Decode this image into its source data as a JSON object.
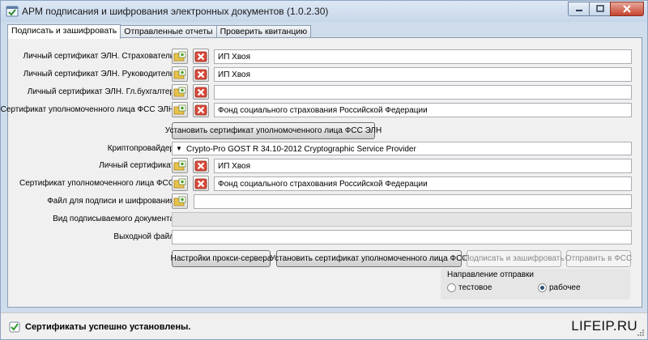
{
  "window": {
    "title": "АРМ подписания и шифрования электронных документов (1.0.2.30)"
  },
  "tabs": [
    {
      "label": "Подписать и зашифровать",
      "active": true
    },
    {
      "label": "Отправленные отчеты",
      "active": false
    },
    {
      "label": "Проверить квитанцию",
      "active": false
    }
  ],
  "certs": {
    "insurer": {
      "label": "Личный сертификат ЭЛН. Страхователь",
      "value": "ИП Хвоя"
    },
    "director": {
      "label": "Личный сертификат ЭЛН. Руководитель",
      "value": "ИП Хвоя"
    },
    "accountant": {
      "label": "Личный сертификат ЭЛН. Гл.бухгалтер",
      "value": ""
    },
    "fss_eln": {
      "label": "Сертификат уполномоченного лица ФСС ЭЛН",
      "value": "Фонд социального страхования Российской Федерации"
    }
  },
  "install_fss_eln_button": "Установить сертификат уполномоченного лица ФСС ЭЛН",
  "crypto": {
    "label": "Криптопровайдер",
    "value": "Crypto-Pro GOST R 34.10-2012 Cryptographic Service Provider"
  },
  "personal": {
    "label": "Личный сертификат",
    "value": "ИП Хвоя"
  },
  "fss": {
    "label": "Сертификат уполномоченного лица ФСС",
    "value": "Фонд социального страхования Российской Федерации"
  },
  "file": {
    "label": "Файл для подписи и шифрования",
    "value": ""
  },
  "doc_type": {
    "label": "Вид подписываемого документа",
    "value": ""
  },
  "output": {
    "label": "Выходной файл",
    "value": ""
  },
  "buttons": {
    "proxy": "Настройки прокси-сервера",
    "install_fss": "Установить сертификат уполномоченного лица ФСС",
    "sign": "Подписать и зашифровать",
    "send": "Отправить в ФСС"
  },
  "direction": {
    "title": "Направление отправки",
    "options": [
      {
        "label": "тестовое",
        "selected": false
      },
      {
        "label": "рабочее",
        "selected": true
      }
    ]
  },
  "status": {
    "text": "Сертификаты успешно установлены."
  },
  "watermark": "LIFEIP.RU",
  "colors": {
    "titlebar": "#cfdcec",
    "close": "#c7442f",
    "panel": "#f0f0f0"
  },
  "icons": {
    "pick": "folder-certificate-icon",
    "delete": "red-x-icon"
  }
}
